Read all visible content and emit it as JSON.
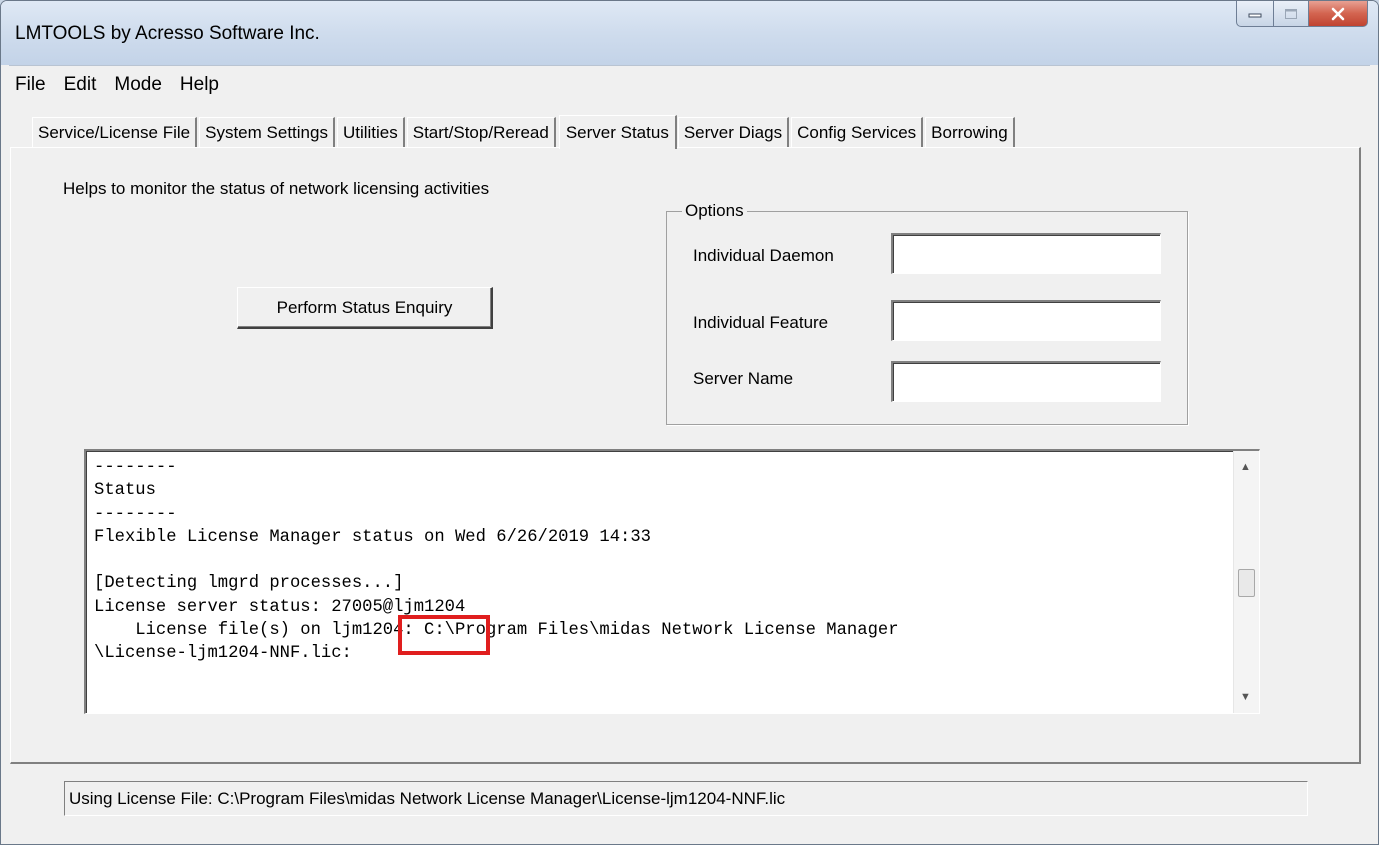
{
  "window": {
    "title": "LMTOOLS by Acresso Software Inc."
  },
  "menu": [
    "File",
    "Edit",
    "Mode",
    "Help"
  ],
  "tabs": [
    {
      "label": "Service/License File",
      "active": false
    },
    {
      "label": "System Settings",
      "active": false
    },
    {
      "label": "Utilities",
      "active": false
    },
    {
      "label": "Start/Stop/Reread",
      "active": false
    },
    {
      "label": "Server Status",
      "active": true
    },
    {
      "label": "Server Diags",
      "active": false
    },
    {
      "label": "Config Services",
      "active": false
    },
    {
      "label": "Borrowing",
      "active": false
    }
  ],
  "panel": {
    "help_text": "Helps to monitor the status of network licensing activities",
    "perform_button": "Perform Status Enquiry",
    "options": {
      "legend": "Options",
      "individual_daemon_label": "Individual Daemon",
      "individual_daemon_value": "",
      "individual_feature_label": "Individual Feature",
      "individual_feature_value": "",
      "server_name_label": "Server Name",
      "server_name_value": ""
    },
    "output_text": "--------\nStatus\n--------\nFlexible License Manager status on Wed 6/26/2019 14:33\n\n[Detecting lmgrd processes...]\nLicense server status: 27005@ljm1204\n    License file(s) on ljm1204: C:\\Program Files\\midas Network License Manager\n\\License-ljm1204-NNF.lic:"
  },
  "status_bar": {
    "text": "Using License File:  C:\\Program Files\\midas Network License Manager\\License-ljm1204-NNF.lic"
  },
  "colors": {
    "highlight": "#e01e1e",
    "close_button": "#c9503b"
  }
}
